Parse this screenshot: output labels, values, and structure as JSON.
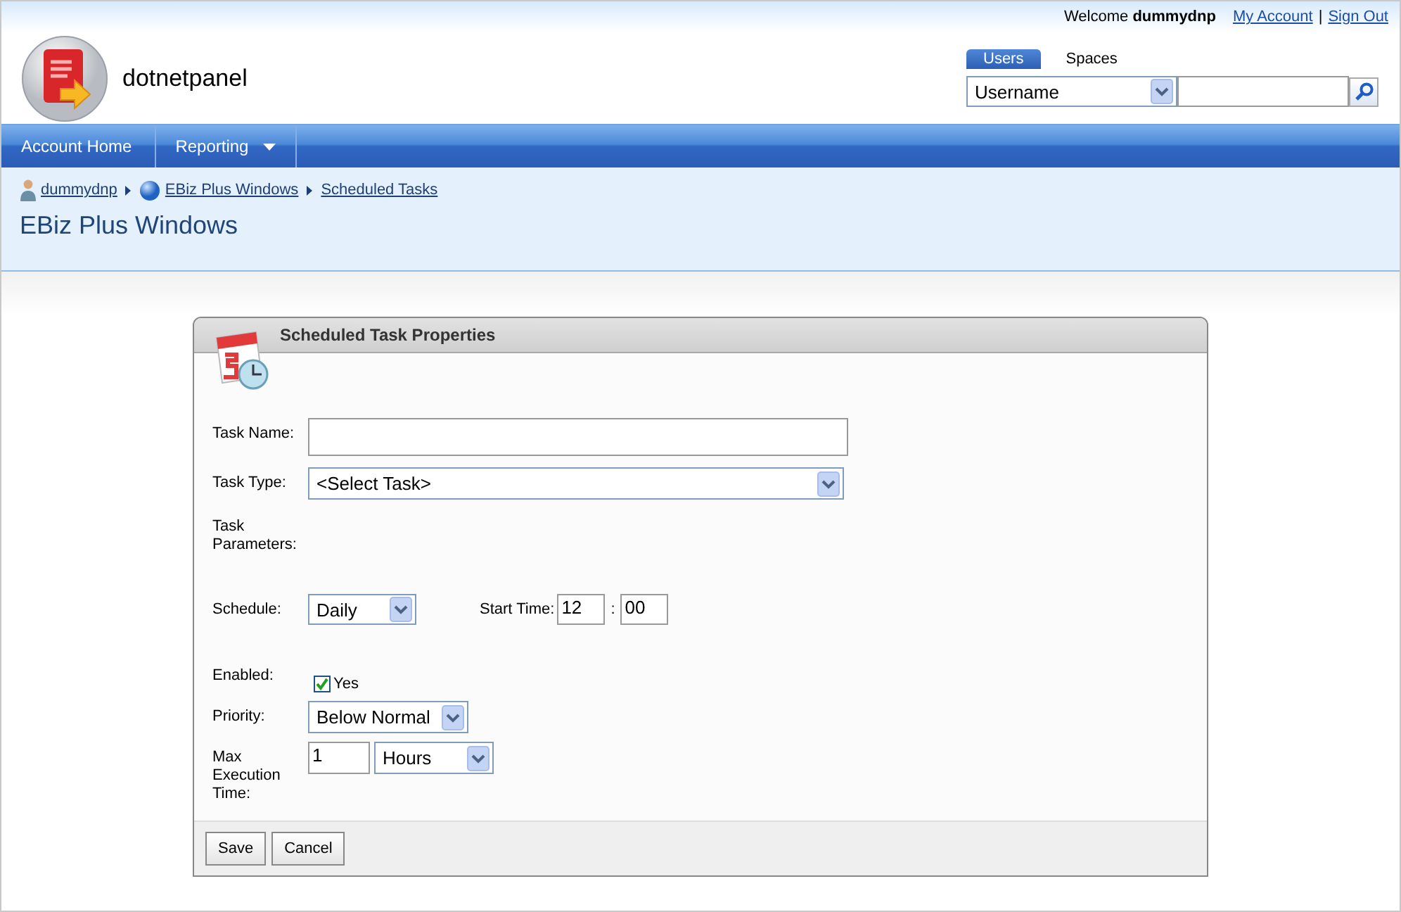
{
  "top_bar": {
    "welcome": "Welcome",
    "user": "dummydnp",
    "links": [
      "My Account",
      "Sign Out"
    ],
    "separator": "|"
  },
  "logo": {
    "text": "dotnetpanel"
  },
  "search": {
    "tabs": [
      {
        "label": "Users",
        "selected": true
      },
      {
        "label": "Spaces",
        "selected": false
      }
    ],
    "field_select": "Username"
  },
  "nav": [
    {
      "label": "Account Home",
      "dropdown": false
    },
    {
      "label": "Reporting",
      "dropdown": true
    }
  ],
  "breadcrumb": [
    {
      "label": "dummydnp",
      "kind": "user"
    },
    {
      "label": "EBiz Plus Windows",
      "kind": "space"
    },
    {
      "label": "Scheduled Tasks",
      "kind": "page"
    }
  ],
  "page_title": "EBiz Plus Windows",
  "panel": {
    "title": "Scheduled Task Properties",
    "fields": [
      {
        "kind": "text",
        "label": "Task Name:"
      },
      {
        "kind": "select_wide",
        "label": "Task Type:",
        "value": "<Select Task>"
      },
      {
        "kind": "params",
        "label": "Task Parameters:"
      },
      {
        "kind": "schedule",
        "label": "Schedule:",
        "value": "Daily",
        "start_label": "Start Time:",
        "hour": "12",
        "separator": ":",
        "minute": "00"
      },
      {
        "kind": "checkbox",
        "label": "Enabled:",
        "checked": true,
        "text": "Yes"
      },
      {
        "kind": "select",
        "label": "Priority:",
        "value": "Below Normal"
      },
      {
        "kind": "duration",
        "label": "Max Execution Time:",
        "amount": "1",
        "unit": "Hours"
      }
    ],
    "buttons": [
      "Save",
      "Cancel"
    ]
  }
}
